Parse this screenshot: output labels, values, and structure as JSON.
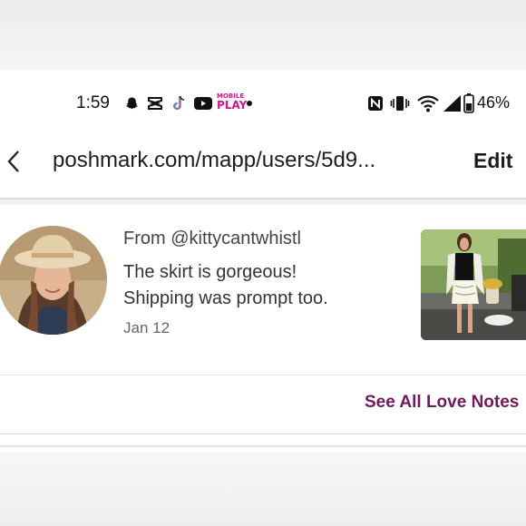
{
  "status_bar": {
    "time": "1:59",
    "notification_icons": [
      "snapchat-icon",
      "capcut-icon",
      "tiktok-icon",
      "youtube-icon",
      "play-mobile-icon"
    ],
    "play_badge_top": "MOBILE",
    "play_badge_bottom": "PLAY",
    "battery_percent": "46%",
    "system_icons": [
      "nfc-icon",
      "vibrate-icon",
      "wifi-icon",
      "cell-signal-icon",
      "battery-icon"
    ]
  },
  "browser": {
    "url": "poshmark.com/mapp/users/5d9...",
    "edit_label": "Edit"
  },
  "love_note": {
    "from": "From @kittycantwhistl",
    "message_lines": [
      "The skirt is gorgeous!",
      "Shipping was prompt too."
    ],
    "date": "Jan 12"
  },
  "see_all_label": "See All Love Notes",
  "colors": {
    "accent": "#6d1b5c",
    "play_badge": "#d4148a"
  }
}
